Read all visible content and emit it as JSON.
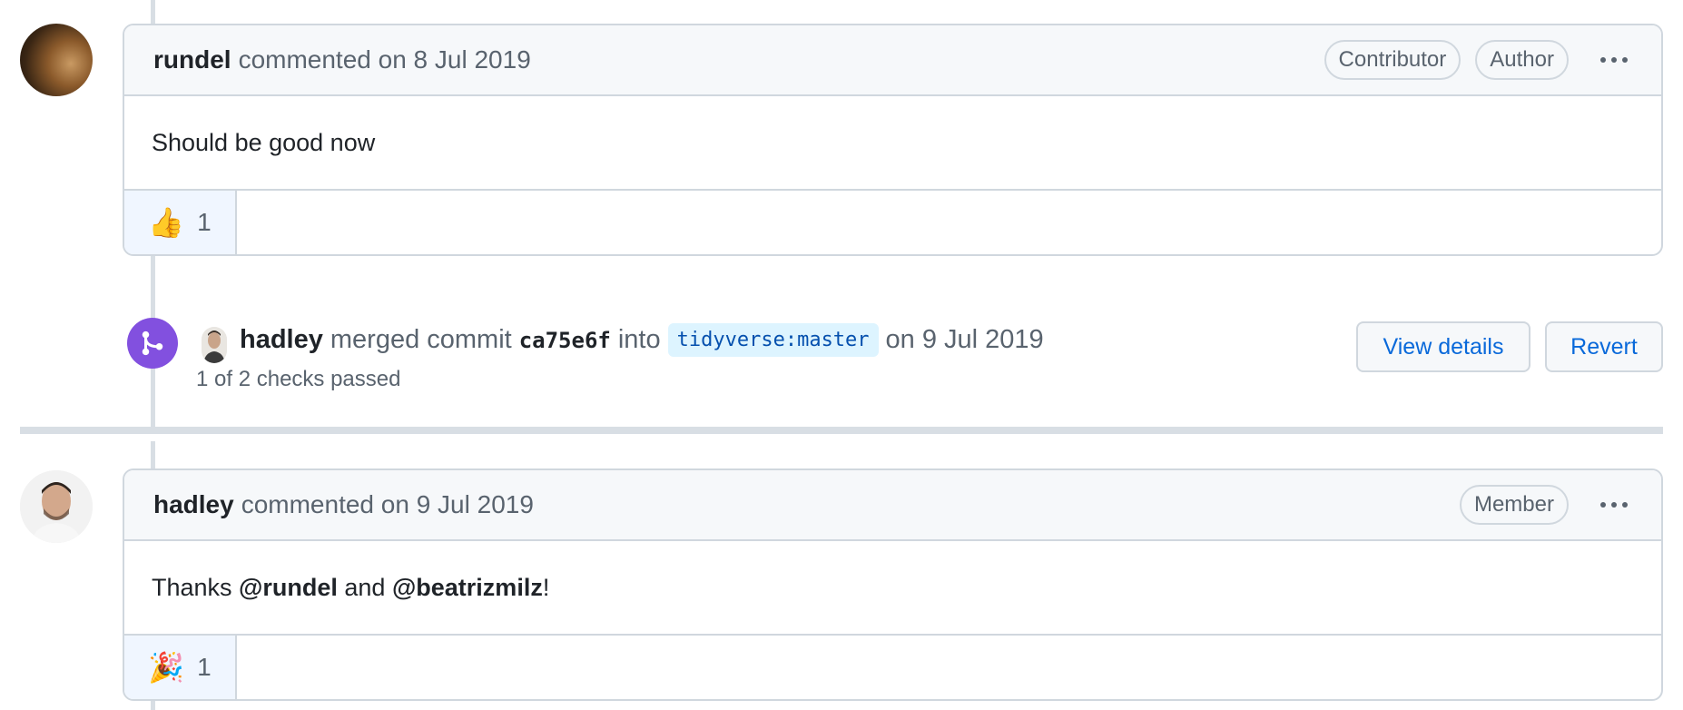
{
  "comment1": {
    "author": "rundel",
    "action": "commented on 8 Jul 2019",
    "badges": [
      "Contributor",
      "Author"
    ],
    "body": "Should be good now",
    "reaction": {
      "emoji": "👍",
      "count": "1"
    }
  },
  "merge_event": {
    "actor": "hadley",
    "text_merged": "merged commit",
    "commit": "ca75e6f",
    "text_into": "into",
    "branch": "tidyverse:master",
    "date": "on 9 Jul 2019",
    "checks": "1 of 2 checks passed",
    "buttons": {
      "view_details": "View details",
      "revert": "Revert"
    }
  },
  "comment2": {
    "author": "hadley",
    "action": "commented on 9 Jul 2019",
    "badges": [
      "Member"
    ],
    "body_prefix": "Thanks ",
    "mention1": "@rundel",
    "body_mid": " and ",
    "mention2": "@beatrizmilz",
    "body_suffix": "!",
    "reaction": {
      "emoji": "🎉",
      "count": "1"
    }
  },
  "colors": {
    "merge_purple": "#8250df",
    "link_blue": "#0969da",
    "border": "#d0d7de"
  }
}
